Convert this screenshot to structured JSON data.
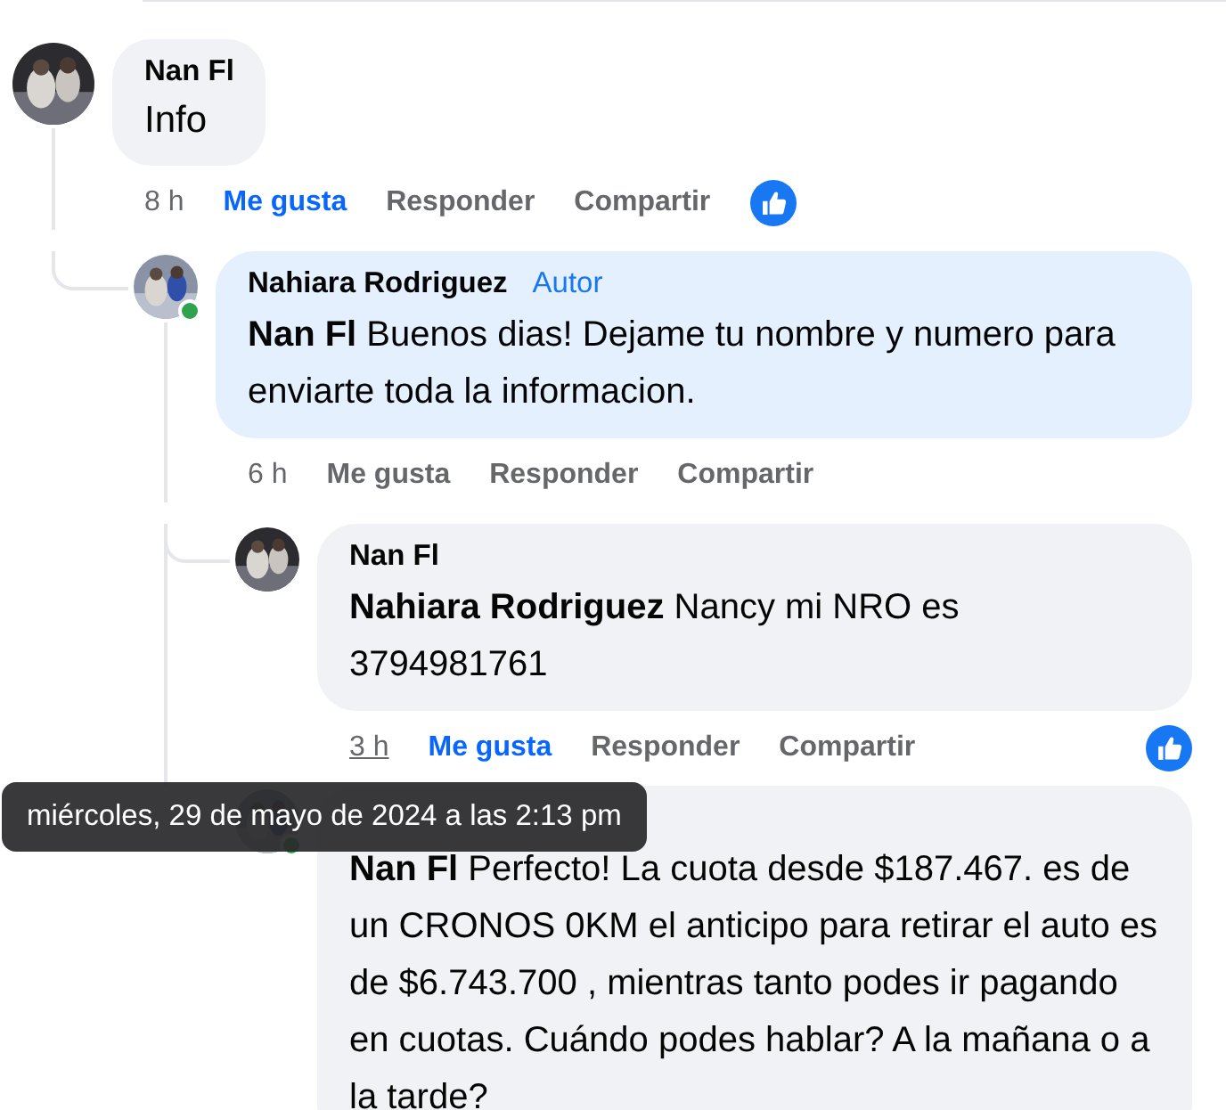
{
  "comments": [
    {
      "author": "Nan Fl",
      "text": "Info",
      "time": "8 h",
      "liked": true,
      "online": false,
      "highlighted": false,
      "reaction": true,
      "actions": [
        "Me gusta",
        "Responder",
        "Compartir"
      ],
      "children": [
        {
          "author": "Nahiara Rodriguez",
          "badge": "Autor",
          "text": "**Nan Fl** Buenos dias! Dejame tu nombre y numero para enviarte toda la informacion.",
          "time": "6 h",
          "liked": false,
          "online": true,
          "highlighted": true,
          "reaction": false,
          "actions": [
            "Me gusta",
            "Responder",
            "Compartir"
          ],
          "children": [
            {
              "author": "Nan Fl",
              "text": "**Nahiara Rodriguez** Nancy mi NRO es 3794981761",
              "time": "3 h",
              "tooltip": "miércoles, 29 de mayo de 2024 a las 2:13 pm",
              "liked": true,
              "online": false,
              "highlighted": false,
              "reaction": true,
              "actions": [
                "Me gusta",
                "Responder",
                "Compartir"
              ]
            },
            {
              "text": "**Nan Fl** Perfecto! La cuota desde $187.467. es de un CRONOS 0KM el anticipo para retirar el auto es de $6.743.700 , mientras tanto podes ir pagando en cuotas. Cuándo podes hablar? A la mañana o a la tarde?",
              "online": true,
              "highlighted": false
            }
          ]
        }
      ]
    }
  ]
}
